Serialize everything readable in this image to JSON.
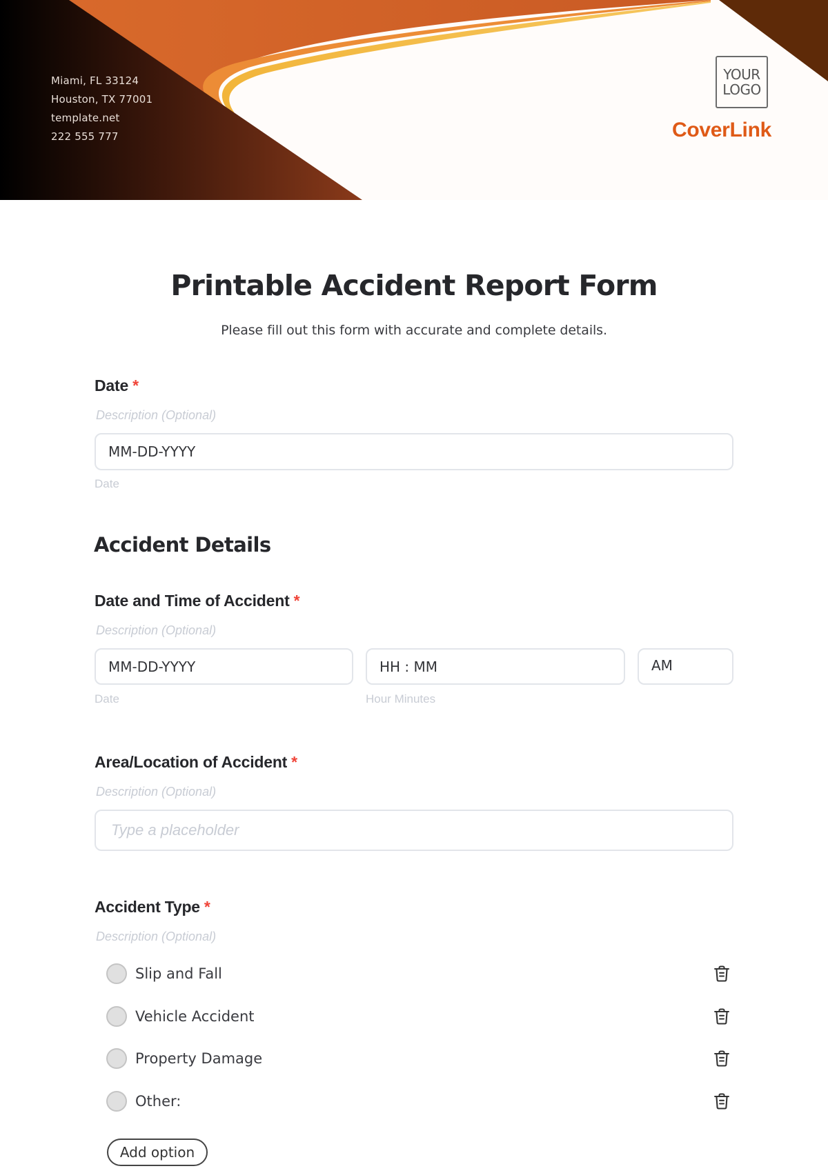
{
  "header": {
    "contact_lines": [
      "Miami, FL 33124",
      "Houston, TX 77001",
      "template.net",
      "222 555 777"
    ],
    "logo_placeholder": [
      "YOUR",
      "LOGO"
    ],
    "brand_name": "CoverLink",
    "colors": {
      "dark": "#1a0a05",
      "rust": "#8a3a1a",
      "orange": "#d4632a",
      "light_orange": "#ec8c36",
      "gold": "#f2b53a",
      "corner_brown": "#5e2a08",
      "brand": "#df5a17"
    }
  },
  "form": {
    "title": "Printable Accident Report Form",
    "subtitle": "Please fill out this form with accurate and complete details.",
    "required_marker": "*",
    "fields": {
      "date": {
        "label": "Date",
        "description": "Description (Optional)",
        "value": "MM-DD-YYYY",
        "helper": "Date"
      },
      "date_time": {
        "label": "Date and Time of Accident",
        "description": "Description (Optional)",
        "date_value": "MM-DD-YYYY",
        "date_helper": "Date",
        "time_value": "HH : MM",
        "time_helper": "Hour Minutes",
        "period_value": "AM"
      },
      "location": {
        "label": "Area/Location of Accident",
        "description": "Description (Optional)",
        "placeholder": "Type a placeholder"
      },
      "accident_type": {
        "label": "Accident Type",
        "description": "Description (Optional)",
        "options": [
          "Slip and Fall",
          "Vehicle Accident",
          "Property Damage",
          "Other:"
        ],
        "add_option_label": "Add option"
      }
    },
    "section_title": "Accident Details"
  }
}
